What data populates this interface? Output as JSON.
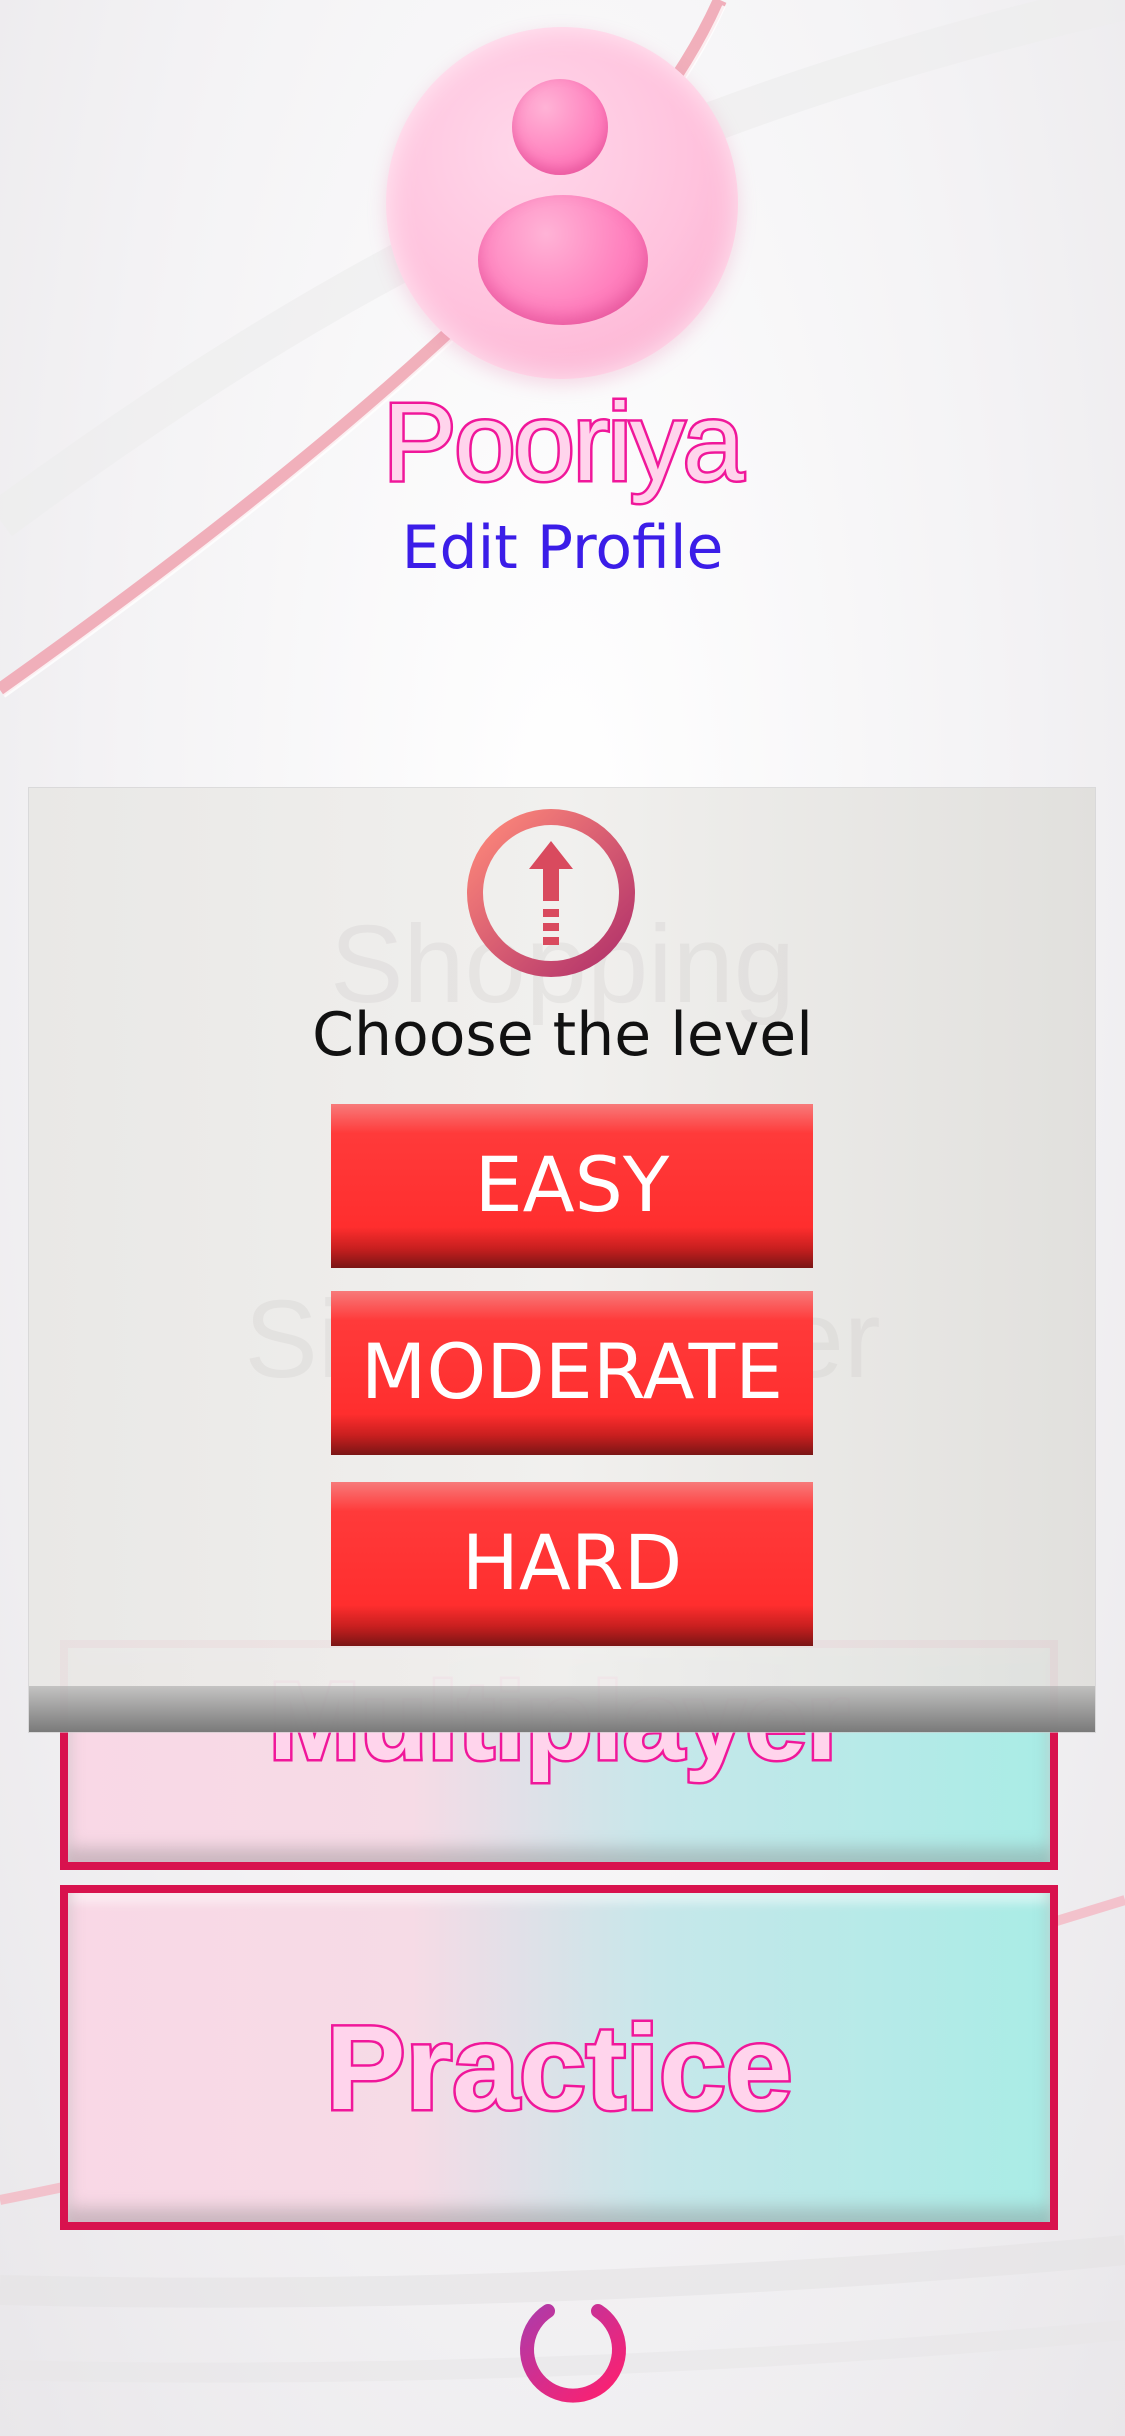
{
  "profile": {
    "username": "Pooriya",
    "edit_label": "Edit Profile",
    "avatar_icon": "user-avatar-icon"
  },
  "menu": {
    "faded_labels": [
      "Shopping",
      "Single player",
      "Multiplayer"
    ],
    "multiplayer_label": "Multiplayer",
    "practice_label": "Practice"
  },
  "dialog": {
    "icon": "upload-arrow-icon",
    "title": "Choose the level",
    "levels": [
      "EASY",
      "MODERATE",
      "HARD"
    ]
  },
  "footer": {
    "power_icon": "power-icon"
  },
  "colors": {
    "accent_pink": "#f0179a",
    "link_blue": "#3b1de8",
    "button_red": "#ff2e2e",
    "border_red": "#d8124e"
  }
}
